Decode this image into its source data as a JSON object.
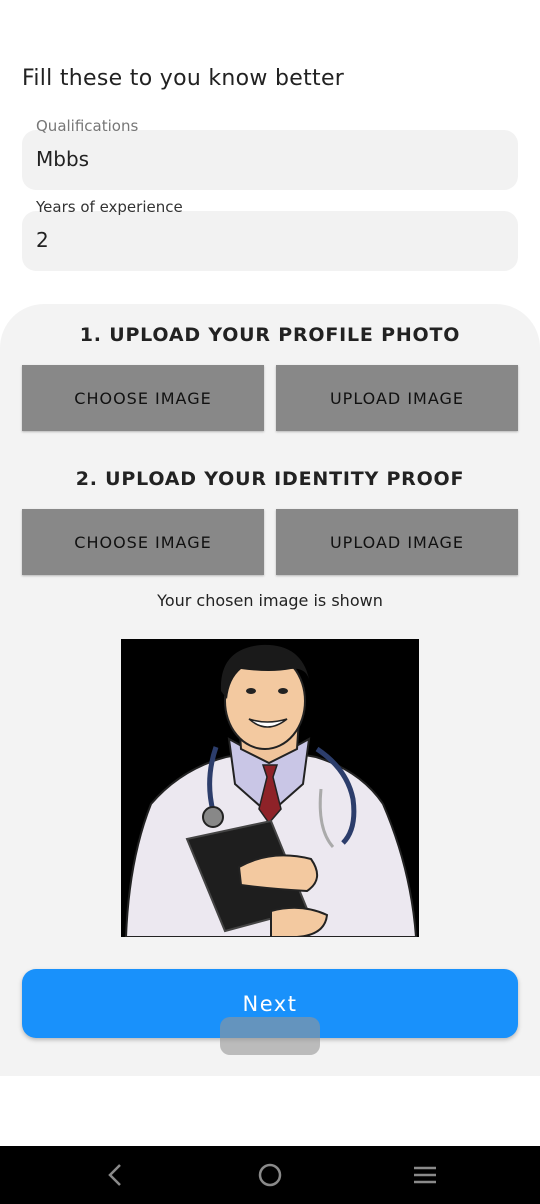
{
  "heading": "Fill these to you know better",
  "qualifications": {
    "label": "Qualifications",
    "value": "Mbbs"
  },
  "experience": {
    "label": "Years of experience",
    "value": "2"
  },
  "profile_photo": {
    "title": "1. UPLOAD YOUR PROFILE PHOTO",
    "choose_label": "CHOOSE IMAGE",
    "upload_label": "UPLOAD IMAGE"
  },
  "identity_proof": {
    "title": "2. UPLOAD YOUR IDENTITY PROOF",
    "choose_label": "CHOOSE IMAGE",
    "upload_label": "UPLOAD IMAGE"
  },
  "caption": "Your chosen image is shown",
  "next_label": "Next",
  "colors": {
    "primary": "#1991fb",
    "button_gray": "#888888",
    "panel": "#f3f3f3"
  },
  "nav": {
    "back_icon": "back-icon",
    "home_icon": "home-icon",
    "menu_icon": "menu-icon"
  }
}
